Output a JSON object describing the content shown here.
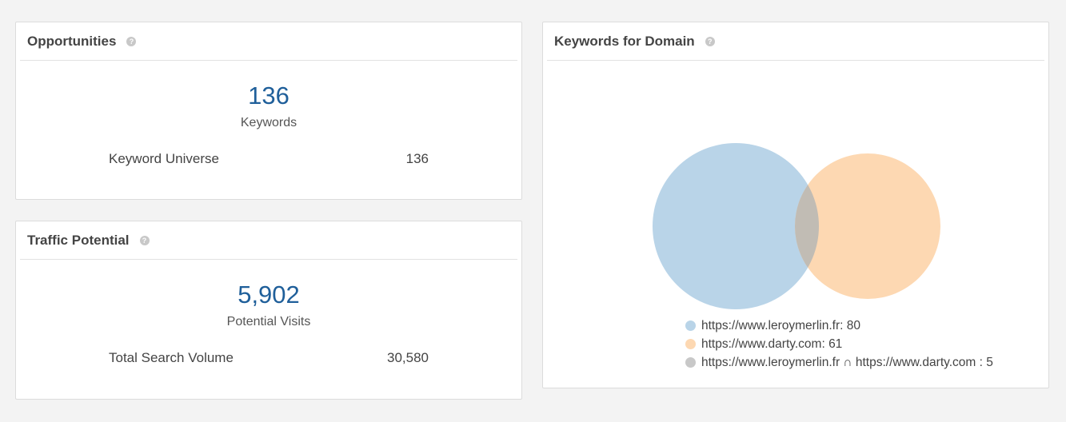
{
  "opportunities": {
    "title": "Opportunities",
    "help": "?",
    "big_value": "136",
    "big_label": "Keywords",
    "row_label": "Keyword Universe",
    "row_value": "136"
  },
  "traffic": {
    "title": "Traffic Potential",
    "help": "?",
    "big_value": "5,902",
    "big_label": "Potential Visits",
    "row_label": "Total Search Volume",
    "row_value": "30,580"
  },
  "keywords_domain": {
    "title": "Keywords for Domain",
    "help": "?",
    "legend": [
      {
        "label": "https://www.leroymerlin.fr: 80",
        "color": "#b9d4e8"
      },
      {
        "label": "https://www.darty.com: 61",
        "color": "#fdd8b2"
      },
      {
        "label": "https://www.leroymerlin.fr ∩ https://www.darty.com : 5",
        "color": "#c8c8c8"
      }
    ]
  },
  "colors": {
    "accent": "#1f5f9a",
    "set_a": "#b9d4e8",
    "set_b": "#fdd8b2",
    "overlap": "#c1bcb4"
  },
  "chart_data": {
    "type": "venn",
    "sets": [
      {
        "name": "https://www.leroymerlin.fr",
        "size": 80
      },
      {
        "name": "https://www.darty.com",
        "size": 61
      }
    ],
    "intersection": {
      "name": "https://www.leroymerlin.fr ∩ https://www.darty.com",
      "size": 5
    }
  }
}
